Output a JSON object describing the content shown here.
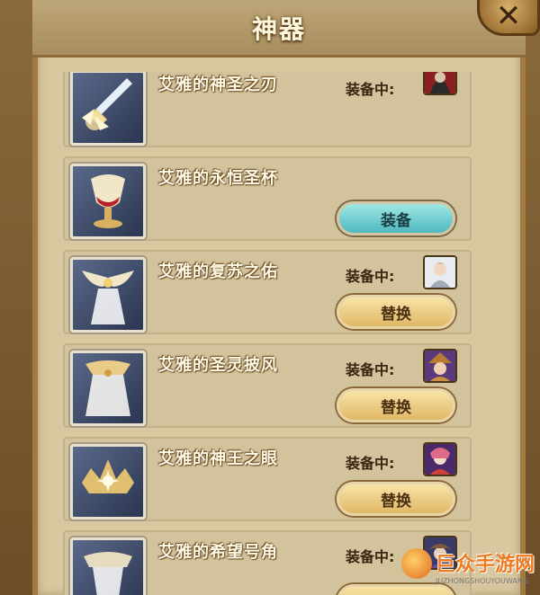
{
  "window": {
    "title": "神器"
  },
  "close_icon": "close-icon",
  "artifacts": [
    {
      "name": "艾雅的神圣之刃",
      "status": "装备中:",
      "button": "",
      "icon": "sword-icon",
      "avatar": "hooded-hero-avatar"
    },
    {
      "name": "艾雅的永恒圣杯",
      "status": "",
      "button": "装备",
      "icon": "chalice-icon",
      "avatar": ""
    },
    {
      "name": "艾雅的复苏之佑",
      "status": "装备中:",
      "button": "替换",
      "icon": "winged-relic-icon",
      "avatar": "silver-hero-avatar"
    },
    {
      "name": "艾雅的圣灵披风",
      "status": "装备中:",
      "button": "替换",
      "icon": "cloak-icon",
      "avatar": "hat-hero-avatar"
    },
    {
      "name": "艾雅的神王之眼",
      "status": "装备中:",
      "button": "替换",
      "icon": "crown-eye-icon",
      "avatar": "pink-hero-avatar"
    },
    {
      "name": "艾雅的希望号角",
      "status": "装备中:",
      "button": "",
      "icon": "horn-icon",
      "avatar": "mage-hero-avatar"
    }
  ],
  "watermark": {
    "title": "巨众手游网",
    "subtitle": "JUZHONGSHOUYOUWANG"
  },
  "colors": {
    "equip_button": "#4fb8c0",
    "swap_button": "#e0b866",
    "panel": "#d8c8a0"
  }
}
